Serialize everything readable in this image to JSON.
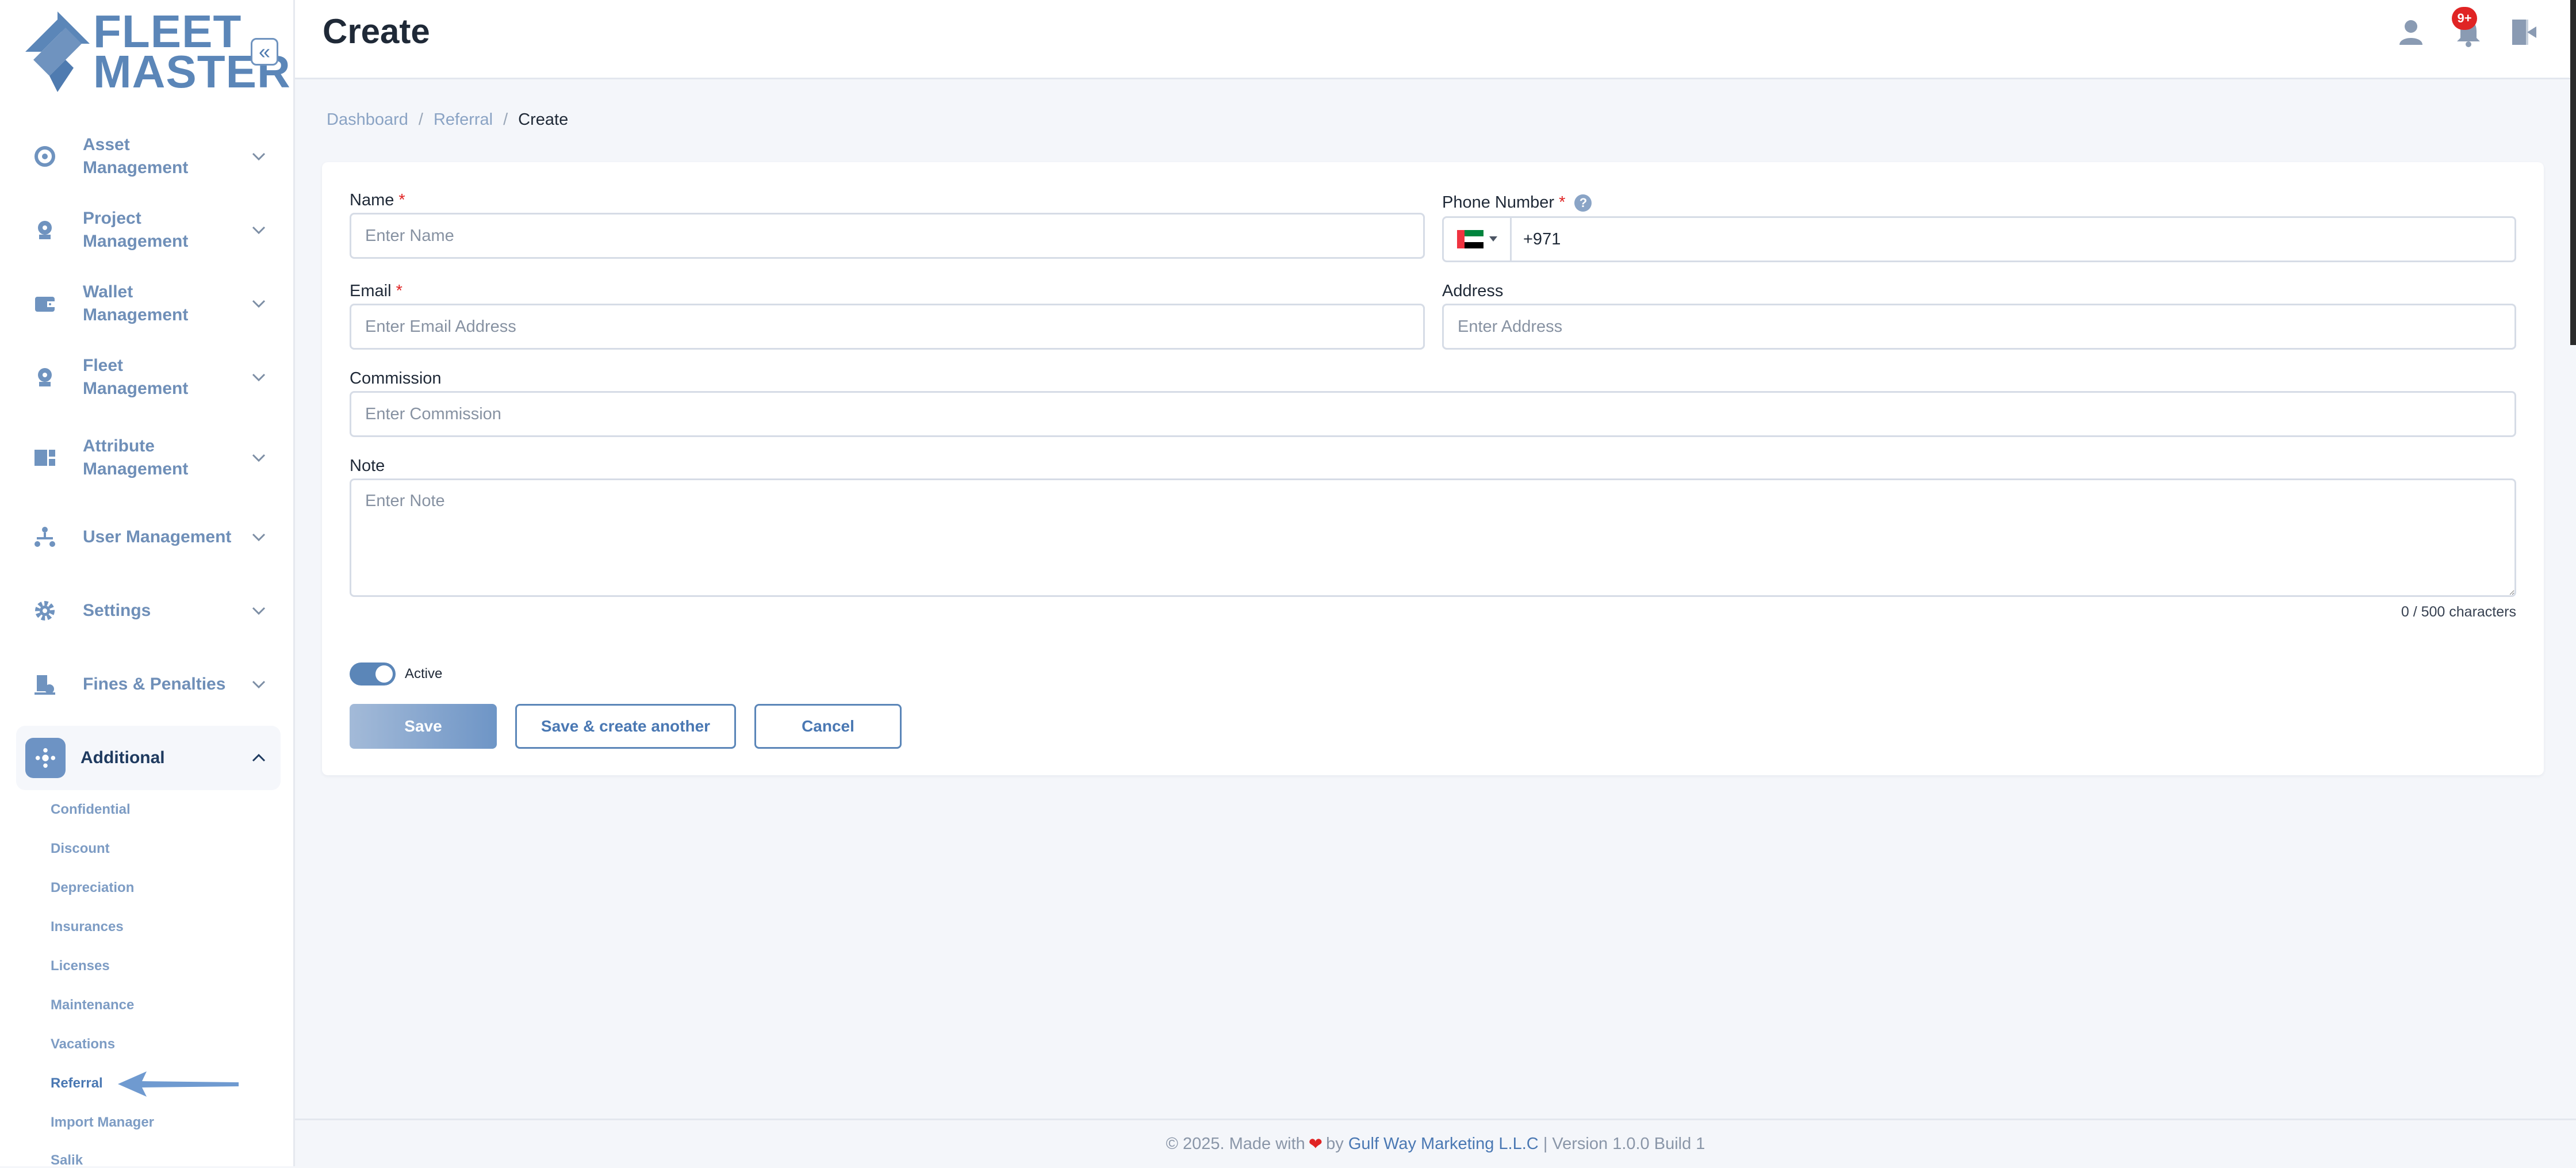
{
  "brand": {
    "line1": "FLEET",
    "line2": "MASTER",
    "accent": "#5b86b8"
  },
  "sidebar": {
    "collapse_icon": "chevrons-left-icon",
    "items": [
      {
        "label": "Asset Management",
        "icon": "asset-icon"
      },
      {
        "label": "Project Management",
        "icon": "project-icon"
      },
      {
        "label": "Wallet Management",
        "icon": "wallet-icon"
      },
      {
        "label": "Fleet Management",
        "icon": "fleet-icon"
      },
      {
        "label": "Attribute Management",
        "icon": "attribute-icon"
      },
      {
        "label": "User Management",
        "icon": "user-hierarchy-icon"
      },
      {
        "label": "Settings",
        "icon": "gear-icon"
      },
      {
        "label": "Fines & Penalties",
        "icon": "fines-icon"
      },
      {
        "label": "Additional",
        "icon": "additional-icon",
        "expanded": true
      }
    ],
    "sub_items": [
      "Confidential",
      "Discount",
      "Depreciation",
      "Insurances",
      "Licenses",
      "Maintenance",
      "Vacations",
      "Referral",
      "Import Manager",
      "Salik"
    ],
    "current_sub": "Referral"
  },
  "header": {
    "title": "Create",
    "notification_badge": "9+",
    "icons": [
      "user-icon",
      "bell-icon",
      "logout-icon"
    ]
  },
  "breadcrumb": [
    "Dashboard",
    "Referral",
    "Create"
  ],
  "form": {
    "name": {
      "label": "Name",
      "required": "*",
      "placeholder": "Enter Name",
      "value": ""
    },
    "phone": {
      "label": "Phone Number",
      "required": "*",
      "help": "?",
      "country": "AE",
      "value": "+971"
    },
    "email": {
      "label": "Email",
      "required": "*",
      "placeholder": "Enter Email Address",
      "value": ""
    },
    "address": {
      "label": "Address",
      "placeholder": "Enter Address",
      "value": ""
    },
    "commission": {
      "label": "Commission",
      "placeholder": "Enter Commission",
      "value": ""
    },
    "note": {
      "label": "Note",
      "placeholder": "Enter Note",
      "value": "",
      "counter": "0 / 500 characters"
    },
    "active": {
      "label": "Active",
      "on": true
    },
    "buttons": {
      "save": "Save",
      "save_another": "Save & create another",
      "cancel": "Cancel"
    }
  },
  "footer": {
    "prefix": "© 2025. Made with",
    "by": "by",
    "company": "Gulf Way Marketing L.L.C",
    "suffix": "| Version 1.0.0 Build 1"
  }
}
